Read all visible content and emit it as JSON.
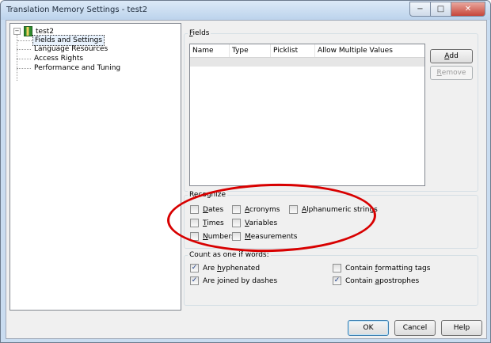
{
  "window": {
    "title": "Translation Memory Settings - test2",
    "controls": [
      "−",
      "□",
      "✕"
    ]
  },
  "tree": {
    "root": "test2",
    "expander": "−",
    "items": [
      "Fields and Settings",
      "Language Resources",
      "Access Rights",
      "Performance and Tuning"
    ],
    "selected_index": 0
  },
  "fields": {
    "legend_u": "F",
    "legend_rest": "ields",
    "columns": [
      "Name",
      "Type",
      "Picklist",
      "Allow Multiple Values"
    ],
    "add_u": "A",
    "add_rest": "dd",
    "remove_u": "R",
    "remove_rest": "emove"
  },
  "recognize": {
    "legend": "Recognize",
    "options": [
      {
        "u": "D",
        "rest": "ates",
        "checked": false
      },
      {
        "u": "T",
        "rest": "imes",
        "checked": false
      },
      {
        "u": "N",
        "rest": "umbers",
        "checked": false
      },
      {
        "u": "A",
        "rest": "cronyms",
        "checked": false
      },
      {
        "u": "V",
        "rest": "ariables",
        "checked": false
      },
      {
        "u": "M",
        "rest": "easurements",
        "checked": false
      },
      {
        "u": "A",
        "rest": "lphanumeric strings",
        "checked": false
      }
    ]
  },
  "count": {
    "legend": "Count as one if words:",
    "options": [
      {
        "pre": "Are ",
        "u": "h",
        "rest": "yphenated",
        "checked": true
      },
      {
        "pre": "Are ",
        "u": "j",
        "rest": "oined by dashes",
        "checked": true
      },
      {
        "pre": "Contain ",
        "u": "f",
        "rest": "ormatting tags",
        "checked": false
      },
      {
        "pre": "Contain ",
        "u": "a",
        "rest": "postrophes",
        "checked": true
      }
    ]
  },
  "footer": {
    "ok": "OK",
    "cancel": "Cancel",
    "help": "Help"
  },
  "annotation_color": "#d80000"
}
